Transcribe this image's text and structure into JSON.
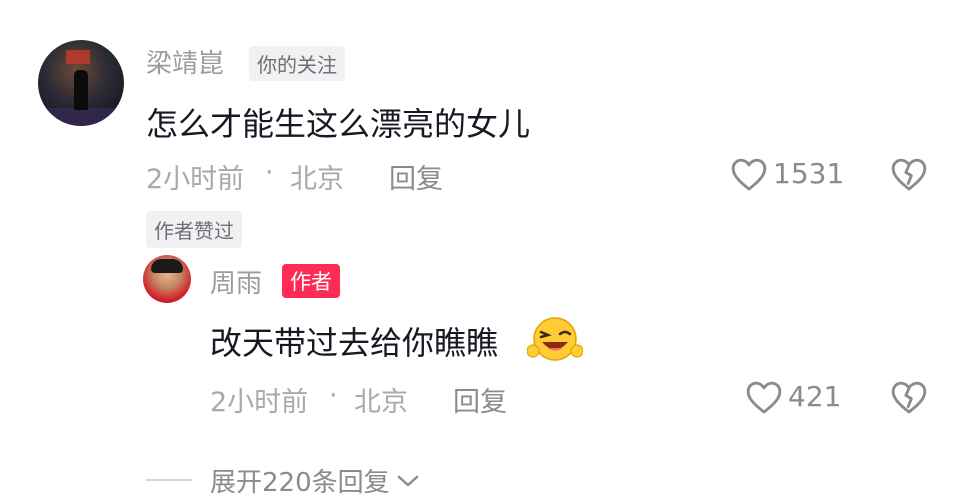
{
  "comment": {
    "username": "梁靖崑",
    "relation_tag": "你的关注",
    "text": "怎么才能生这么漂亮的女儿",
    "time": "2小时前",
    "location": "北京",
    "reply_label": "回复",
    "like_count": "1531",
    "author_liked_tag": "作者赞过"
  },
  "reply": {
    "username": "周雨",
    "author_tag": "作者",
    "text": "改天带过去给你瞧瞧",
    "emoji": "grinning-wink-emoji",
    "time": "2小时前",
    "location": "北京",
    "reply_label": "回复",
    "like_count": "421"
  },
  "expand": {
    "label": "展开220条回复"
  },
  "separator": "·",
  "colors": {
    "author_tag": "#fe2c55",
    "secondary_text": "#9b9ba1",
    "primary_text": "#161823"
  }
}
